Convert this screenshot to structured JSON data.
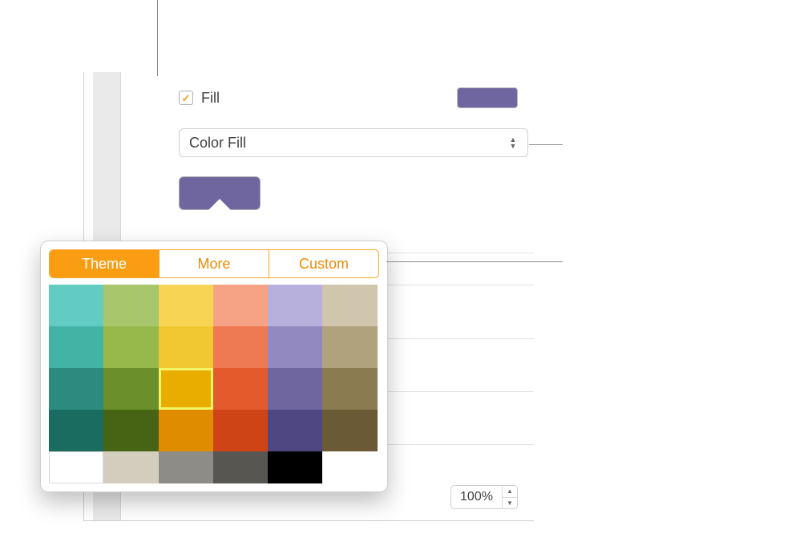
{
  "fill": {
    "label": "Fill",
    "checked": true,
    "swatch_color": "#6f669f",
    "type_label": "Color Fill",
    "current_color": "#6f669f"
  },
  "opacity": {
    "value": "100%"
  },
  "popover": {
    "tabs": {
      "theme": "Theme",
      "more": "More",
      "custom": "Custom"
    },
    "active_tab": "theme",
    "selected_index": 14,
    "colors_main": [
      "#63ccc2",
      "#a8c66c",
      "#f7d453",
      "#f6a285",
      "#b7b0dc",
      "#cfc6ad",
      "#43b3a6",
      "#97b94c",
      "#f1c732",
      "#ee7a54",
      "#9289c1",
      "#b1a27e",
      "#2c8a7e",
      "#6b8f2a",
      "#e9ad00",
      "#e55a2c",
      "#6f669f",
      "#8b7b50",
      "#1a6b60",
      "#476414",
      "#e08c00",
      "#cf4416",
      "#4e4781",
      "#6a5a36"
    ],
    "colors_bottom": [
      "#ffffff",
      "#d3cdbd",
      "#8e8c87",
      "#585650",
      "#000000"
    ]
  }
}
